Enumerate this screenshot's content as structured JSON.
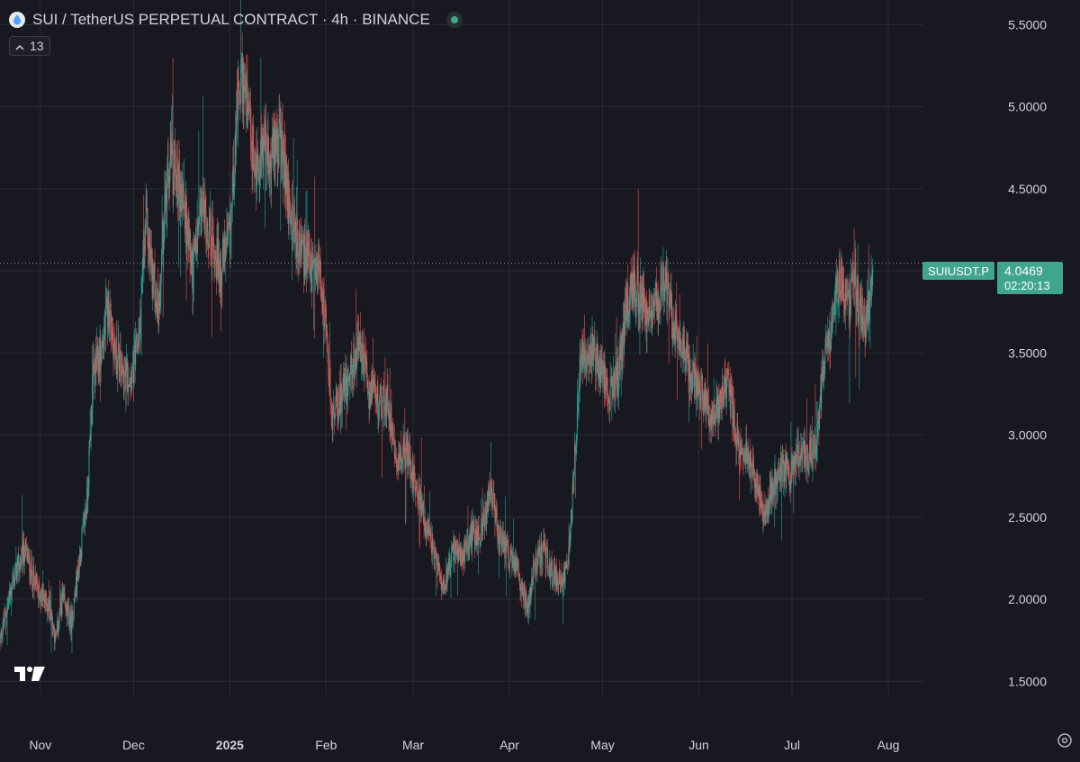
{
  "header": {
    "title": "SUI / TetherUS PERPETUAL CONTRACT · 4h · BINANCE",
    "indicator_count": "13"
  },
  "icons": {
    "symbol": "sui-logo-icon",
    "status": "market-open-dot-icon",
    "collapse": "chevron-up-icon",
    "brand": "tradingview-logo-icon",
    "settings": "gear-icon"
  },
  "colors": {
    "background": "#181820",
    "up": "#26a69a",
    "down": "#ef5350",
    "grid": "#2a2c36",
    "price_label": "#3fa58c"
  },
  "price_tag": {
    "symbol": "SUIUSDT.P",
    "price": "4.0469",
    "countdown": "02:20:13"
  },
  "chart_data": {
    "type": "candlestick",
    "interval": "4h",
    "ylim": [
      1.2,
      5.65
    ],
    "y_ticks": [
      "5.5000",
      "5.0000",
      "4.5000",
      "4.0000",
      "3.5000",
      "3.0000",
      "2.5000",
      "2.0000",
      "1.5000"
    ],
    "y_tick_values": [
      5.5,
      5.0,
      4.5,
      4.0,
      3.5,
      3.0,
      2.5,
      2.0,
      1.5
    ],
    "x_ticks": [
      "Nov",
      "Dec",
      "2025",
      "Feb",
      "Mar",
      "Apr",
      "May",
      "Jun",
      "Jul",
      "Aug"
    ],
    "x_tick_dates": [
      "2024-11-01",
      "2024-12-01",
      "2025-01-01",
      "2025-02-01",
      "2025-03-01",
      "2025-04-01",
      "2025-05-01",
      "2025-06-01",
      "2025-07-01",
      "2025-08-01"
    ],
    "x_range": [
      "2024-10-19",
      "2025-08-12"
    ],
    "last_price": 4.0469,
    "grid": true,
    "series": [
      {
        "approx_closes": [
          [
            "2024-10-19",
            1.75
          ],
          [
            "2024-10-23",
            2.1
          ],
          [
            "2024-10-27",
            2.3
          ],
          [
            "2024-10-31",
            2.05
          ],
          [
            "2024-11-04",
            1.95
          ],
          [
            "2024-11-06",
            1.75
          ],
          [
            "2024-11-08",
            2.0
          ],
          [
            "2024-11-11",
            1.85
          ],
          [
            "2024-11-14",
            2.3
          ],
          [
            "2024-11-16",
            2.6
          ],
          [
            "2024-11-18",
            3.35
          ],
          [
            "2024-11-21",
            3.55
          ],
          [
            "2024-11-23",
            3.8
          ],
          [
            "2024-11-25",
            3.5
          ],
          [
            "2024-11-28",
            3.35
          ],
          [
            "2024-12-01",
            3.4
          ],
          [
            "2024-12-03",
            3.65
          ],
          [
            "2024-12-05",
            4.3
          ],
          [
            "2024-12-07",
            4.0
          ],
          [
            "2024-12-09",
            3.75
          ],
          [
            "2024-12-11",
            4.4
          ],
          [
            "2024-12-13",
            4.65
          ],
          [
            "2024-12-15",
            4.55
          ],
          [
            "2024-12-17",
            4.45
          ],
          [
            "2024-12-20",
            4.0
          ],
          [
            "2024-12-23",
            4.4
          ],
          [
            "2024-12-26",
            4.2
          ],
          [
            "2024-12-29",
            4.0
          ],
          [
            "2025-01-01",
            4.2
          ],
          [
            "2025-01-03",
            4.9
          ],
          [
            "2025-01-05",
            5.2
          ],
          [
            "2025-01-07",
            4.9
          ],
          [
            "2025-01-09",
            4.6
          ],
          [
            "2025-01-12",
            4.8
          ],
          [
            "2025-01-14",
            4.6
          ],
          [
            "2025-01-16",
            4.85
          ],
          [
            "2025-01-18",
            4.7
          ],
          [
            "2025-01-20",
            4.4
          ],
          [
            "2025-01-23",
            4.15
          ],
          [
            "2025-01-26",
            4.05
          ],
          [
            "2025-01-28",
            3.95
          ],
          [
            "2025-01-30",
            4.05
          ],
          [
            "2025-02-01",
            3.6
          ],
          [
            "2025-02-03",
            3.1
          ],
          [
            "2025-02-06",
            3.25
          ],
          [
            "2025-02-09",
            3.4
          ],
          [
            "2025-02-12",
            3.55
          ],
          [
            "2025-02-15",
            3.25
          ],
          [
            "2025-02-18",
            3.2
          ],
          [
            "2025-02-21",
            3.2
          ],
          [
            "2025-02-24",
            2.85
          ],
          [
            "2025-02-27",
            2.9
          ],
          [
            "2025-03-02",
            2.7
          ],
          [
            "2025-03-05",
            2.45
          ],
          [
            "2025-03-08",
            2.25
          ],
          [
            "2025-03-11",
            2.1
          ],
          [
            "2025-03-14",
            2.3
          ],
          [
            "2025-03-17",
            2.25
          ],
          [
            "2025-03-20",
            2.4
          ],
          [
            "2025-03-23",
            2.4
          ],
          [
            "2025-03-26",
            2.65
          ],
          [
            "2025-03-29",
            2.35
          ],
          [
            "2025-04-01",
            2.25
          ],
          [
            "2025-04-04",
            2.15
          ],
          [
            "2025-04-07",
            1.95
          ],
          [
            "2025-04-09",
            2.2
          ],
          [
            "2025-04-12",
            2.3
          ],
          [
            "2025-04-15",
            2.15
          ],
          [
            "2025-04-18",
            2.1
          ],
          [
            "2025-04-20",
            2.25
          ],
          [
            "2025-04-22",
            2.85
          ],
          [
            "2025-04-24",
            3.5
          ],
          [
            "2025-04-27",
            3.55
          ],
          [
            "2025-04-30",
            3.4
          ],
          [
            "2025-05-03",
            3.25
          ],
          [
            "2025-05-06",
            3.35
          ],
          [
            "2025-05-09",
            3.85
          ],
          [
            "2025-05-12",
            3.9
          ],
          [
            "2025-05-15",
            3.75
          ],
          [
            "2025-05-18",
            3.8
          ],
          [
            "2025-05-21",
            3.95
          ],
          [
            "2025-05-24",
            3.65
          ],
          [
            "2025-05-27",
            3.55
          ],
          [
            "2025-05-30",
            3.35
          ],
          [
            "2025-06-02",
            3.25
          ],
          [
            "2025-06-05",
            3.1
          ],
          [
            "2025-06-08",
            3.2
          ],
          [
            "2025-06-10",
            3.35
          ],
          [
            "2025-06-13",
            3.0
          ],
          [
            "2025-06-16",
            2.9
          ],
          [
            "2025-06-19",
            2.75
          ],
          [
            "2025-06-22",
            2.5
          ],
          [
            "2025-06-25",
            2.7
          ],
          [
            "2025-06-28",
            2.8
          ],
          [
            "2025-07-01",
            2.75
          ],
          [
            "2025-07-03",
            2.9
          ],
          [
            "2025-07-06",
            2.85
          ],
          [
            "2025-07-09",
            2.95
          ],
          [
            "2025-07-11",
            3.45
          ],
          [
            "2025-07-13",
            3.55
          ],
          [
            "2025-07-15",
            3.9
          ],
          [
            "2025-07-17",
            3.95
          ],
          [
            "2025-07-19",
            3.8
          ],
          [
            "2025-07-21",
            3.95
          ],
          [
            "2025-07-23",
            3.75
          ],
          [
            "2025-07-25",
            3.7
          ],
          [
            "2025-07-27",
            4.05
          ]
        ]
      }
    ]
  }
}
